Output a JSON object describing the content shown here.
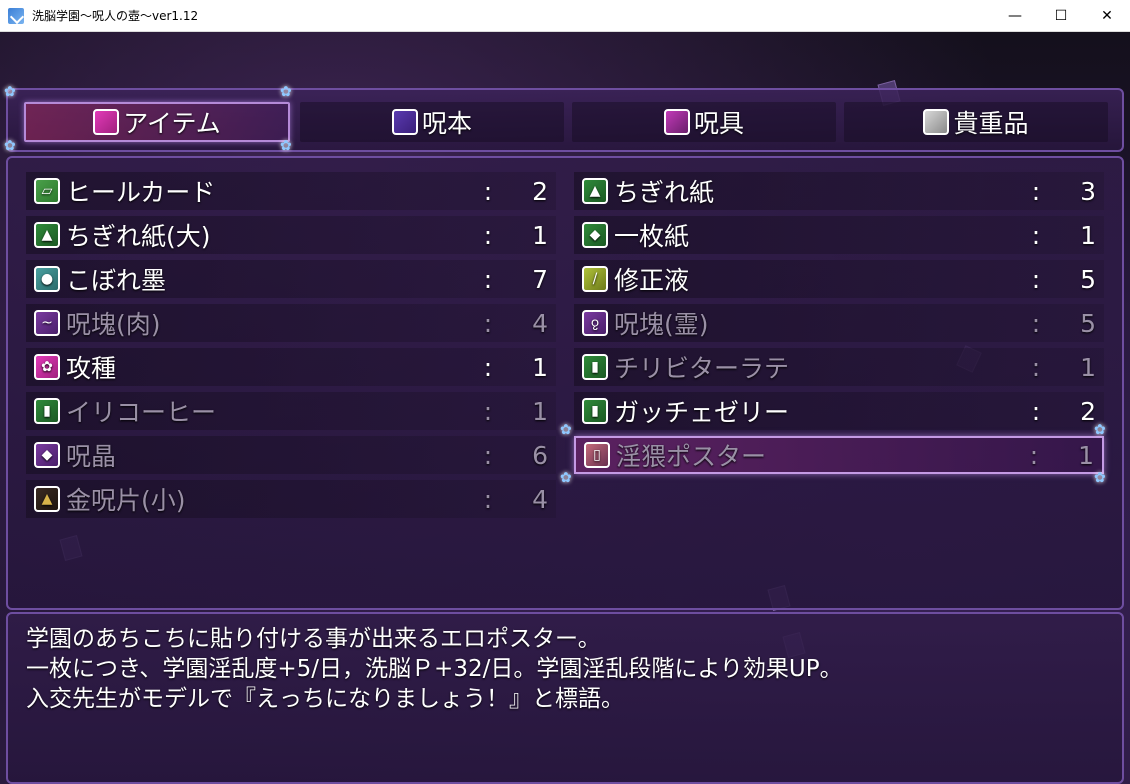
{
  "window": {
    "title": "洗脳学園～呪人の壺～ver1.12",
    "minimize": "—",
    "maximize": "☐",
    "close": "✕"
  },
  "tabs": [
    {
      "label": "アイテム",
      "icon": "gem-icon",
      "active": true
    },
    {
      "label": "呪本",
      "icon": "book-icon",
      "active": false
    },
    {
      "label": "呪具",
      "icon": "skeleton-icon",
      "active": false
    },
    {
      "label": "貴重品",
      "icon": "picture-icon",
      "active": false
    }
  ],
  "items_left": [
    {
      "name": "ヒールカード",
      "colon": ":",
      "qty": "2",
      "icon": "card-icon",
      "enabled": true
    },
    {
      "name": "ちぎれ紙(大)",
      "colon": ":",
      "qty": "1",
      "icon": "torn-paper-icon",
      "enabled": true
    },
    {
      "name": "こぼれ墨",
      "colon": ":",
      "qty": "7",
      "icon": "ink-jar-icon",
      "enabled": true
    },
    {
      "name": "呪塊(肉)",
      "colon": ":",
      "qty": "4",
      "icon": "curse-flesh-icon",
      "enabled": false
    },
    {
      "name": "攻種",
      "colon": ":",
      "qty": "1",
      "icon": "seed-icon",
      "enabled": true
    },
    {
      "name": "イリコーヒー",
      "colon": ":",
      "qty": "1",
      "icon": "mug-icon",
      "enabled": false
    },
    {
      "name": "呪晶",
      "colon": ":",
      "qty": "6",
      "icon": "crystal-icon",
      "enabled": false
    },
    {
      "name": "金呪片(小)",
      "colon": ":",
      "qty": "4",
      "icon": "gold-shard-icon",
      "enabled": false
    }
  ],
  "items_right": [
    {
      "name": "ちぎれ紙",
      "colon": ":",
      "qty": "3",
      "icon": "torn-paper-icon",
      "enabled": true
    },
    {
      "name": "一枚紙",
      "colon": ":",
      "qty": "1",
      "icon": "paper-sheet-icon",
      "enabled": true
    },
    {
      "name": "修正液",
      "colon": ":",
      "qty": "5",
      "icon": "correction-fluid-icon",
      "enabled": true
    },
    {
      "name": "呪塊(霊)",
      "colon": ":",
      "qty": "5",
      "icon": "curse-spirit-icon",
      "enabled": false
    },
    {
      "name": "チリビターラテ",
      "colon": ":",
      "qty": "1",
      "icon": "mug-icon",
      "enabled": false
    },
    {
      "name": "ガッチェゼリー",
      "colon": ":",
      "qty": "2",
      "icon": "mug-icon",
      "enabled": true
    },
    {
      "name": "淫猥ポスター",
      "colon": ":",
      "qty": "1",
      "icon": "poster-icon",
      "enabled": false,
      "selected": true
    }
  ],
  "description": [
    "学園のあちこちに貼り付ける事が出来るエロポスター。",
    "一枚につき、学園淫乱度+5/日，洗脳Ｐ+32/日。学園淫乱段階により効果UP。",
    "入交先生がモデルで『えっちになりましょう！』と標語。"
  ]
}
